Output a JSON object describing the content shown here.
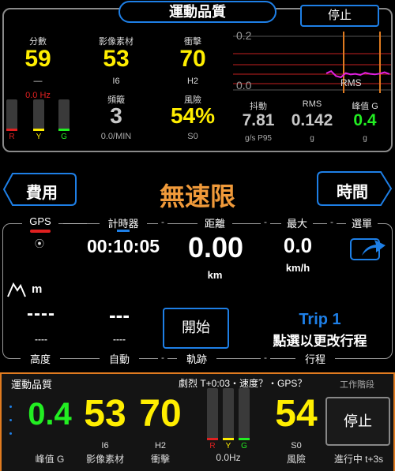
{
  "top_panel": {
    "title": "運動品質",
    "stop_label": "停止",
    "score": {
      "label": "分數",
      "value": "59",
      "dash": "—",
      "hz": "0.0 Hz"
    },
    "footage": {
      "label": "影像素材",
      "value": "53",
      "sub": "I6"
    },
    "impact": {
      "label": "衝擊",
      "value": "70",
      "sub": "H2"
    },
    "freq": {
      "label": "頻簸",
      "value": "3",
      "sub": "0.0/MIN"
    },
    "risk": {
      "label": "風險",
      "value": "54%",
      "sub": "S0"
    },
    "bars": {
      "r": "R",
      "y": "Y",
      "g": "G"
    },
    "graph": {
      "top": "0.2",
      "bottom": "0.0",
      "legend": "RMS",
      "series": [
        0.062,
        0.07,
        0.052,
        0.047,
        0.063,
        0.058,
        0.06,
        0.056,
        0.064,
        0.06,
        0.058,
        0.061,
        0.066,
        0.059
      ]
    },
    "jitter": {
      "label": "抖動",
      "value": "7.81",
      "sub": "g/s P95"
    },
    "rms": {
      "label": "RMS",
      "value": "0.142",
      "sub": "g"
    },
    "peak": {
      "label": "峰值 G",
      "value": "0.4",
      "sub": "g"
    }
  },
  "nav": {
    "left_label": "費用",
    "right_label": "時間",
    "center_title": "無速限"
  },
  "main": {
    "gps_label": "GPS",
    "timer_label": "計時器",
    "distance_label": "距離",
    "max_label": "最大",
    "menu_label": "選單",
    "timer_value": "00:10:05",
    "distance_value": "0.00",
    "distance_unit": "km",
    "max_value": "0.0",
    "max_unit": "km/h",
    "altitude_unit": "m",
    "alt_value": "----",
    "alt_sub": "----",
    "auto_value": "---",
    "auto_sub": "----",
    "start_label": "開始",
    "trip_title": "Trip 1",
    "trip_sub": "點選以更改行程",
    "altitude_label": "高度",
    "auto_label": "自動",
    "track_label": "軌跡",
    "trip_label": "行程"
  },
  "bottom": {
    "title": "運動品質",
    "status": "劇烈 T+0:03・速度？・GPS？",
    "phase": "工作階段",
    "peak_value": "0.4",
    "peak_label": "峰值 G",
    "footage_value": "53",
    "footage_sub": "I6",
    "footage_label": "影像素材",
    "impact_value": "70",
    "impact_sub": "H2",
    "impact_label": "衝擊",
    "bars": {
      "r": "R",
      "y": "Y",
      "g": "G"
    },
    "hz": "0.0Hz",
    "risk_value": "54",
    "risk_sub": "S0",
    "risk_label": "風險",
    "stop_label": "停止",
    "progress": "進行中 t+3s"
  }
}
